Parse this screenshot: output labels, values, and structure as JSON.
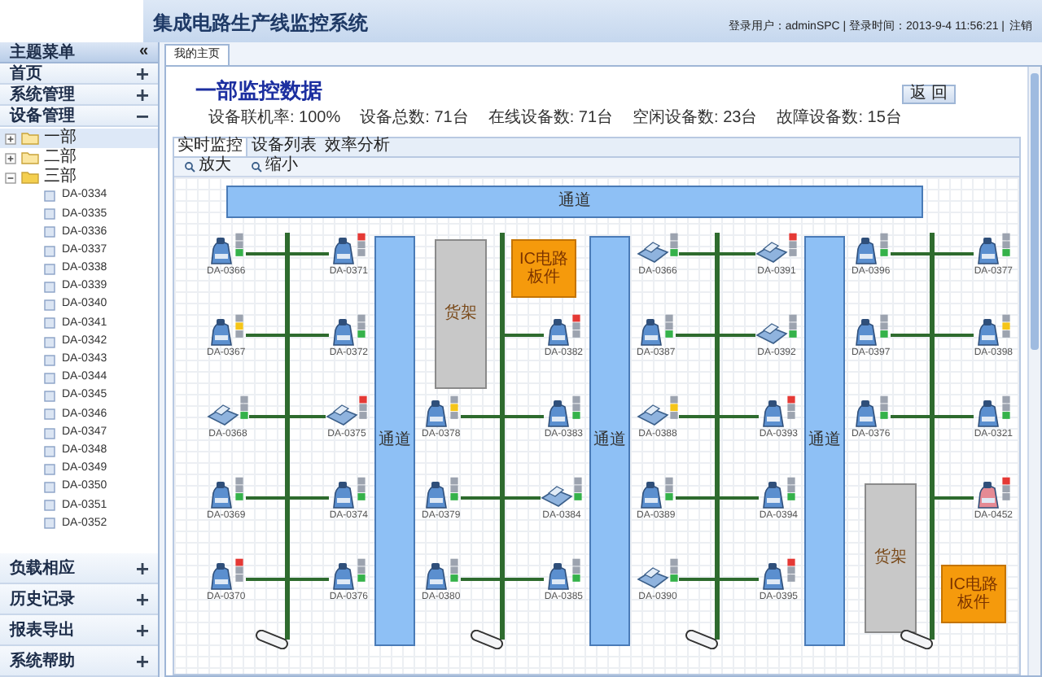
{
  "header": {
    "title": "集成电路生产线监控系统",
    "user_info": "登录用户：adminSPC | 登录时间：2013-9-4 11:56:21 |",
    "logout": "注销"
  },
  "sidebar": {
    "title": "主题菜单",
    "collapse": "«",
    "top_items": [
      {
        "label": "首页",
        "expanded": false
      },
      {
        "label": "系统管理",
        "expanded": false
      },
      {
        "label": "设备管理",
        "expanded": true
      }
    ],
    "tree": [
      {
        "label": "一部",
        "expanded": false,
        "selected": true
      },
      {
        "label": "二部",
        "expanded": false,
        "selected": false
      },
      {
        "label": "三部",
        "expanded": true,
        "selected": false,
        "children": [
          "DA-0334",
          "DA-0335",
          "DA-0336",
          "DA-0337",
          "DA-0338",
          "DA-0339",
          "DA-0340",
          "DA-0341",
          "DA-0342",
          "DA-0343",
          "DA-0344",
          "DA-0345",
          "DA-0346",
          "DA-0347",
          "DA-0348",
          "DA-0349",
          "DA-0350",
          "DA-0351",
          "DA-0352"
        ]
      }
    ],
    "bottom_items": [
      {
        "label": "负载相应",
        "expanded": false
      },
      {
        "label": "历史记录",
        "expanded": false
      },
      {
        "label": "报表导出",
        "expanded": false
      },
      {
        "label": "系统帮助",
        "expanded": false
      }
    ]
  },
  "page_tab": "我的主页",
  "panel": {
    "title": "一部监控数据",
    "back_button": "返 回",
    "stats": [
      "设备联机率: 100%",
      "设备总数: 71台",
      "在线设备数: 71台",
      "空闲设备数: 23台",
      "故障设备数: 15台"
    ],
    "tabs": [
      {
        "label": "实时监控",
        "selected": true
      },
      {
        "label": "设备列表",
        "selected": false
      },
      {
        "label": "效率分析",
        "selected": false
      }
    ],
    "tools": [
      "放大",
      "缩小"
    ]
  },
  "canvas": {
    "top_channel": "通道",
    "channels": [
      "通道",
      "通道",
      "通道"
    ],
    "lines": [
      {
        "left": [
          {
            "kind": "machine",
            "name": "DA-0366",
            "color": "#35b24a"
          },
          {
            "kind": "machine",
            "name": "DA-0367",
            "color": "#f5c518"
          },
          {
            "kind": "scanner",
            "name": "DA-0368",
            "color": "#35b24a"
          },
          {
            "kind": "machine",
            "name": "DA-0369",
            "color": "#35b24a"
          },
          {
            "kind": "machine",
            "name": "DA-0370",
            "color": "#e53935"
          }
        ],
        "right": [
          {
            "kind": "machine",
            "name": "DA-0371",
            "color": "#e53935"
          },
          {
            "kind": "machine",
            "name": "DA-0372",
            "color": "#35b24a"
          },
          {
            "kind": "scanner",
            "name": "DA-0375",
            "color": "#e53935"
          },
          {
            "kind": "machine",
            "name": "DA-0374",
            "color": "#35b24a"
          },
          {
            "kind": "machine",
            "name": "DA-0376",
            "color": "#35b24a"
          }
        ]
      },
      {
        "left": [
          {
            "kind": "rack",
            "label": "货架"
          },
          {
            "kind": "machine",
            "name": "DA-0378",
            "color": "#f5c518"
          },
          {
            "kind": "machine",
            "name": "DA-0379",
            "color": "#35b24a"
          },
          {
            "kind": "machine",
            "name": "DA-0380",
            "color": "#35b24a"
          }
        ],
        "right": [
          {
            "kind": "box",
            "label": "IC电路板件"
          },
          {
            "kind": "machine",
            "name": "DA-0382",
            "color": "#e53935"
          },
          {
            "kind": "machine",
            "name": "DA-0383",
            "color": "#35b24a"
          },
          {
            "kind": "scanner",
            "name": "DA-0384",
            "color": "#35b24a"
          },
          {
            "kind": "machine",
            "name": "DA-0385",
            "color": "#35b24a"
          }
        ]
      },
      {
        "left": [
          {
            "kind": "scanner",
            "name": "DA-0366",
            "color": "#35b24a"
          },
          {
            "kind": "machine",
            "name": "DA-0387",
            "color": "#35b24a"
          },
          {
            "kind": "scanner",
            "name": "DA-0388",
            "color": "#f5c518"
          },
          {
            "kind": "machine",
            "name": "DA-0389",
            "color": "#35b24a"
          },
          {
            "kind": "scanner",
            "name": "DA-0390",
            "color": "#35b24a"
          }
        ],
        "right": [
          {
            "kind": "scanner",
            "name": "DA-0391",
            "color": "#e53935"
          },
          {
            "kind": "scanner",
            "name": "DA-0392",
            "color": "#35b24a"
          },
          {
            "kind": "machine",
            "name": "DA-0393",
            "color": "#e53935"
          },
          {
            "kind": "machine",
            "name": "DA-0394",
            "color": "#35b24a"
          },
          {
            "kind": "machine",
            "name": "DA-0395",
            "color": "#e53935"
          }
        ]
      },
      {
        "left": [
          {
            "kind": "machine",
            "name": "DA-0396",
            "color": "#35b24a"
          },
          {
            "kind": "machine",
            "name": "DA-0397",
            "color": "#35b24a"
          },
          {
            "kind": "machine",
            "name": "DA-0376",
            "color": "#35b24a"
          },
          {
            "kind": "rack",
            "label": "货架"
          }
        ],
        "right": [
          {
            "kind": "machine",
            "name": "DA-0377",
            "color": "#35b24a"
          },
          {
            "kind": "machine",
            "name": "DA-0398",
            "color": "#f5c518"
          },
          {
            "kind": "machine",
            "name": "DA-0321",
            "color": "#35b24a"
          },
          {
            "kind": "alarm-machine",
            "name": "DA-0452",
            "color": "#e53935"
          },
          {
            "kind": "box",
            "label": "IC电路板件"
          }
        ]
      }
    ]
  }
}
